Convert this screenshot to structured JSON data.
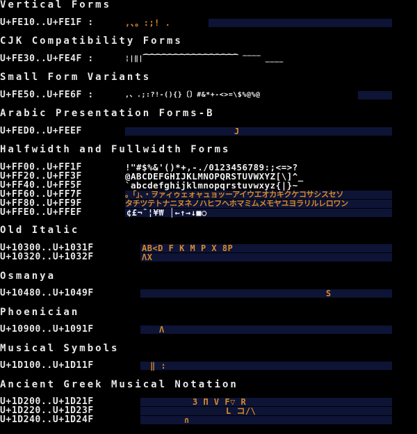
{
  "colors": {
    "background": "#000000",
    "text": "#e8e8e8",
    "strip": "#0e1436",
    "glyph_orange": "#d98a2a"
  },
  "sections": [
    {
      "title": "Vertical Forms",
      "rows": [
        {
          "range": "U+FE10..U+FE1F :",
          "glyphs": ",、。:;!        ."
        }
      ]
    },
    {
      "title": "CJK Compatibility Forms",
      "rows": [
        {
          "range": "U+FE30..U+FE4F :",
          "glyphs": "¦|‖|⁀⁀⁀⁀⁀⁀⁀⁀⁀⁀⁀⁀⁀⁀⁀⁀ ‾‾‾‾ ____"
        }
      ]
    },
    {
      "title": "Small Form Variants",
      "rows": [
        {
          "range": "U+FE50..U+FE6F :",
          "glyphs": ",、.;:?!-(){}〔〕#&*+-<>=\\$%@%@"
        }
      ]
    },
    {
      "title": "Arabic Presentation Forms-B",
      "rows": [
        {
          "range": "U+FED0..U+FEEF",
          "glyphs": "J"
        }
      ]
    },
    {
      "title": "Halfwidth and Fullwidth Forms",
      "rows": [
        {
          "range": "U+FF00..U+FF1F",
          "glyphs": " !\"#$%&'()*+,-./0123456789:;<=>?"
        },
        {
          "range": "U+FF20..U+FF3F",
          "glyphs": "@ABCDEFGHIJKLMNOPQRSTUVWXYZ[\\]^_"
        },
        {
          "range": "U+FF40..U+FF5F",
          "glyphs": "`abcdefghijklmnopqrstuvwxyz{|}~"
        },
        {
          "range": "U+FF60..U+FF7F",
          "glyphs": " 。「」、・ヲァィゥェォャュョッーアイウエオカキクケコサシスセソ"
        },
        {
          "range": "U+FF80..U+FF9F",
          "glyphs": "タチツテトナニヌネノハヒフヘホマミムメモヤユヨラリルレロワン"
        },
        {
          "range": "U+FFE0..U+FFEF",
          "glyphs": "¢£¬¯¦¥₩ │←↑→↓■○"
        }
      ]
    },
    {
      "title": "Old Italic",
      "rows": [
        {
          "range": "U+10300..U+1031F",
          "glyphs": "AB<D F     K        M P     X   8P"
        },
        {
          "range": "U+10320..U+1032F",
          "glyphs": "  ΛX"
        }
      ]
    },
    {
      "title": "Osmanya",
      "rows": [
        {
          "range": "U+10480..U+1049F",
          "glyphs": "S"
        }
      ]
    },
    {
      "title": "Phoenician",
      "rows": [
        {
          "range": "U+10900..U+1091F",
          "glyphs": "Λ"
        }
      ]
    },
    {
      "title": "Musical Symbols",
      "rows": [
        {
          "range": "U+1D100..U+1D11F",
          "glyphs": "‖              :"
        }
      ]
    },
    {
      "title": "Ancient Greek Musical Notation",
      "rows": [
        {
          "range": "U+1D200..U+1D21F",
          "glyphs": "3 Π     V      F▽ R"
        },
        {
          "range": "U+1D220..U+1D23F",
          "glyphs": "L                コ/\\"
        },
        {
          "range": "U+1D240..U+1D24F",
          "glyphs": "∩"
        }
      ]
    }
  ]
}
